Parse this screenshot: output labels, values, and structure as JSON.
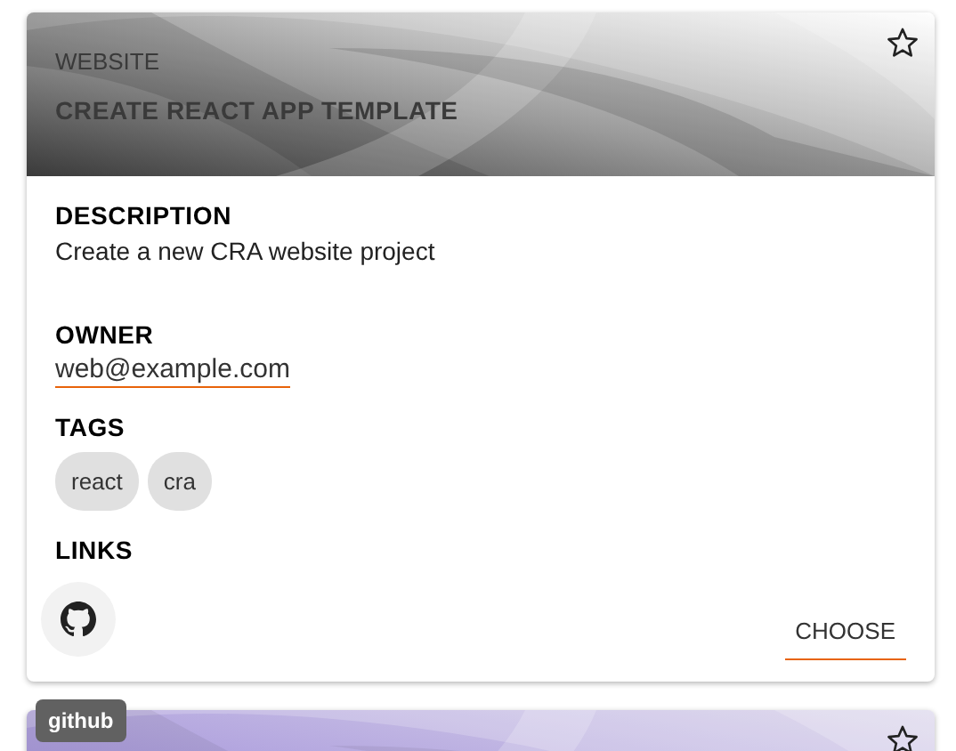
{
  "cards": [
    {
      "kind": "grey",
      "favorite": false,
      "category": "WEBSITE",
      "title": "CREATE REACT APP TEMPLATE",
      "sections": {
        "description_label": "DESCRIPTION",
        "description": "Create a new CRA website project",
        "owner_label": "OWNER",
        "owner": "web@example.com",
        "tags_label": "TAGS",
        "tags": [
          "react",
          "cra"
        ],
        "links_label": "LINKS",
        "links": [
          {
            "kind": "github",
            "hovered": true
          }
        ],
        "action": "CHOOSE"
      }
    },
    {
      "kind": "purple",
      "favorite": false
    }
  ],
  "tooltip": {
    "text": "github"
  }
}
